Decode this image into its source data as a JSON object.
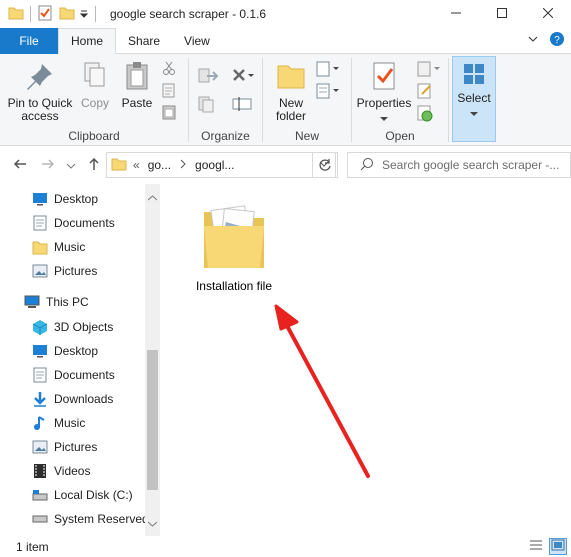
{
  "window": {
    "title": "google search scraper - 0.1.6",
    "minimize_icon": "minimize-icon",
    "maximize_icon": "maximize-icon",
    "close_icon": "close-icon"
  },
  "ribbon_tabs": [
    {
      "label": "File"
    },
    {
      "label": "Home"
    },
    {
      "label": "Share"
    },
    {
      "label": "View"
    }
  ],
  "ribbon": {
    "clipboard": {
      "label": "Clipboard",
      "pin_label": "Pin to Quick access",
      "copy_label": "Copy",
      "paste_label": "Paste"
    },
    "organize": {
      "label": "Organize"
    },
    "new": {
      "label": "New",
      "new_folder_label": "New folder"
    },
    "open": {
      "label": "Open",
      "properties_label": "Properties"
    },
    "select": {
      "label": "Select"
    }
  },
  "address": {
    "crumbs": [
      "go...",
      "googl..."
    ]
  },
  "search": {
    "placeholder": "Search google search scraper -..."
  },
  "nav": {
    "items": [
      {
        "label": "Desktop",
        "icon": "desktop-icon"
      },
      {
        "label": "Documents",
        "icon": "documents-icon"
      },
      {
        "label": "Music",
        "icon": "music-folder-icon"
      },
      {
        "label": "Pictures",
        "icon": "pictures-icon"
      },
      {
        "label": "This PC",
        "icon": "this-pc-icon"
      },
      {
        "label": "3D Objects",
        "icon": "3d-objects-icon"
      },
      {
        "label": "Desktop",
        "icon": "desktop-icon"
      },
      {
        "label": "Documents",
        "icon": "documents-icon"
      },
      {
        "label": "Downloads",
        "icon": "downloads-icon"
      },
      {
        "label": "Music",
        "icon": "music-icon"
      },
      {
        "label": "Pictures",
        "icon": "pictures-icon"
      },
      {
        "label": "Videos",
        "icon": "videos-icon"
      },
      {
        "label": "Local Disk (C:)",
        "icon": "local-disk-icon"
      },
      {
        "label": "System Reserved",
        "icon": "drive-icon"
      }
    ]
  },
  "content": {
    "items": [
      {
        "name": "Installation file",
        "icon": "folder-icon"
      }
    ]
  },
  "status": {
    "count": "1 item"
  },
  "colors": {
    "file_tab": "#1979ca",
    "ribbon_bg": "#f5f6f7",
    "arrow": "#e8231f"
  }
}
